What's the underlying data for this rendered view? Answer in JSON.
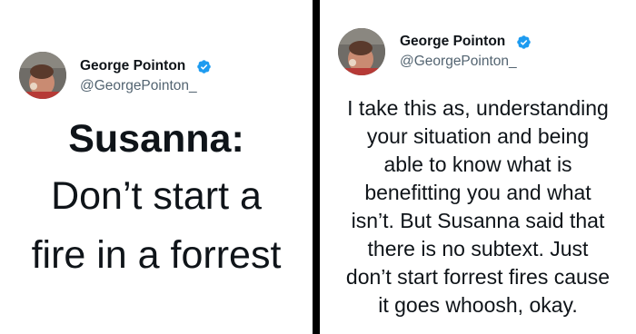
{
  "left_tweet": {
    "author_name": "George Pointon",
    "author_handle": "@GeorgePointon_",
    "text_line1": "Susanna:",
    "text_line2": "Don’t start a",
    "text_line3": "fire in a forrest"
  },
  "right_tweet": {
    "author_name": "George Pointon",
    "author_handle": "@GeorgePointon_",
    "body_lines": [
      "I take this as, understanding",
      "your situation and being",
      "able to know what is",
      "benefitting you and what",
      "isn’t. But Susanna said that",
      "there is no subtext. Just",
      "don’t start forrest fires cause",
      "it goes whoosh, okay."
    ]
  },
  "colors": {
    "verified_badge": "#1d9bf0",
    "divider": "#000000",
    "handle": "#536471",
    "text": "#0f1419"
  },
  "icons": [
    "avatar-photo",
    "verified-badge-icon"
  ]
}
